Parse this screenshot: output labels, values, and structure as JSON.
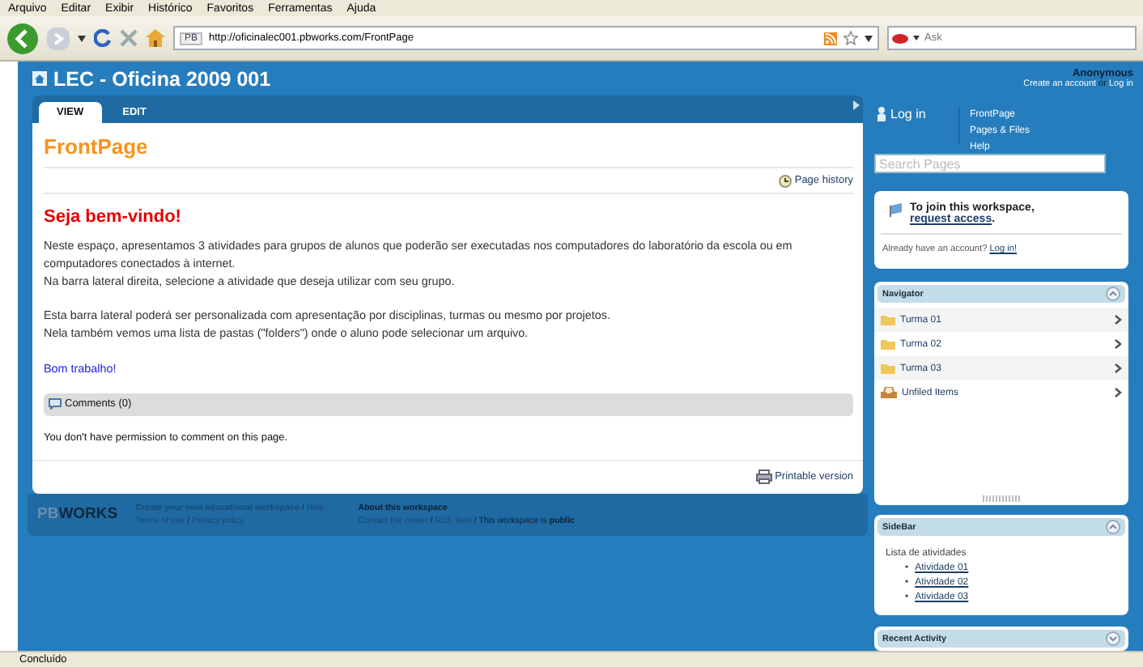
{
  "browser": {
    "menu": [
      "Arquivo",
      "Editar",
      "Exibir",
      "Histórico",
      "Favoritos",
      "Ferramentas",
      "Ajuda"
    ],
    "favicon_text": "PB",
    "url": "http://oficinalec001.pbworks.com/FrontPage",
    "search_placeholder": "Ask"
  },
  "site": {
    "title": "LEC - Oficina 2009 001",
    "user": "Anonymous",
    "create_account": "Create an account",
    "or": "or",
    "log_in": "Log in"
  },
  "tabs": [
    {
      "label": "VIEW",
      "selected": true
    },
    {
      "label": "EDIT",
      "selected": false
    }
  ],
  "page": {
    "title": "FrontPage",
    "history": "Page history",
    "heading": "Seja bem-vindo!",
    "paragraphs": [
      [
        "Neste espaço, apresentamos 3 atividades para grupos de alunos que poderão ser executadas nos computadores do laboratório da escola ou em computadores conectados à internet.",
        "Na barra lateral direita, selecione a atividade que deseja utilizar com seu grupo."
      ],
      [
        "Esta barra lateral poderá ser personalizada com apresentação por disciplinas, turmas ou mesmo por projetos.",
        "Nela também vemos uma lista de pastas (\"folders\") onde o aluno pode selecionar um arquivo."
      ]
    ],
    "closing": "Bom trabalho!",
    "comments": "Comments (0)",
    "permission": "You don't have permission to comment on this page.",
    "printable": "Printable version"
  },
  "footer": {
    "separator": "/",
    "logo_prefix": "PB",
    "logo_main": "WORKS",
    "create": "Create your own educational workspace",
    "help": "Help",
    "terms": "Terms of use",
    "privacy": "Privacy policy",
    "about": "About this workspace",
    "contact": "Contact the owner",
    "rss": "RSS feed",
    "public_text": "This workspace is",
    "public_word": "public"
  },
  "sidebar": {
    "log_in": "Log in",
    "links": [
      "FrontPage",
      "Pages & Files",
      "Help"
    ],
    "search_placeholder": "Search Pages",
    "join_text": "To join this workspace,",
    "join_link": "request access",
    "join_end": ".",
    "account_text": "Already have an account?",
    "account_link": "Log in!",
    "navigator": {
      "title": "Navigator",
      "expanded": true,
      "items": [
        {
          "label": "Turma 01",
          "kind": "folder"
        },
        {
          "label": "Turma 02",
          "kind": "folder"
        },
        {
          "label": "Turma 03",
          "kind": "folder"
        },
        {
          "label": "Unfiled Items",
          "kind": "unfiled"
        }
      ]
    },
    "sidebar_panel": {
      "title": "SideBar",
      "expanded": true,
      "intro": "Lista de atividades",
      "bullet": "•",
      "items": [
        "Atividade 01",
        "Atividade 02",
        "Atividade 03"
      ]
    },
    "recent": {
      "title": "Recent Activity",
      "expanded": false
    }
  },
  "status_bar": "Concluído"
}
